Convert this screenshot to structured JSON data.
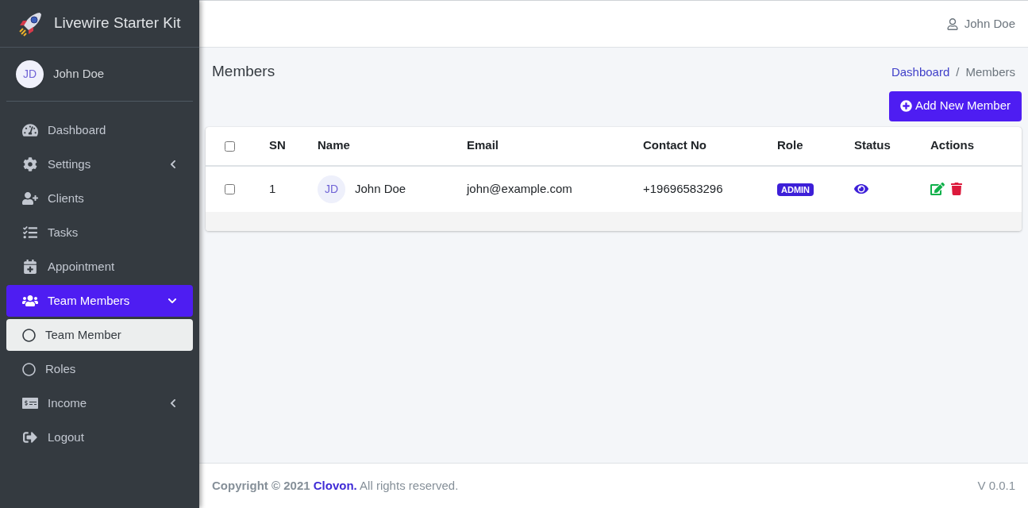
{
  "brand": {
    "name": "Livewire Starter Kit"
  },
  "user": {
    "initials": "JD",
    "name": "John Doe"
  },
  "sidebar": {
    "items": [
      {
        "kind": "link",
        "label": "Dashboard",
        "selected": false
      },
      {
        "kind": "group",
        "label": "Settings",
        "selected": false,
        "expanded": false
      },
      {
        "kind": "link",
        "label": "Clients",
        "selected": false
      },
      {
        "kind": "link",
        "label": "Tasks",
        "selected": false
      },
      {
        "kind": "link",
        "label": "Appointment",
        "selected": false
      },
      {
        "kind": "group",
        "label": "Team Members",
        "selected": true,
        "expanded": true,
        "children": [
          {
            "kind": "sub",
            "label": "Team Member",
            "selected": true
          },
          {
            "kind": "sub",
            "label": "Roles",
            "selected": false
          }
        ]
      },
      {
        "kind": "group",
        "label": "Income",
        "selected": false,
        "expanded": false
      },
      {
        "kind": "link",
        "label": "Logout",
        "selected": false
      }
    ]
  },
  "header": {
    "user": "John Doe"
  },
  "page": {
    "title": "Members",
    "breadcrumb_separator": "/",
    "breadcrumb": [
      {
        "label": "Dashboard",
        "link": true
      },
      {
        "label": "Members",
        "link": false
      }
    ],
    "add_button": "Add New Member"
  },
  "table": {
    "select_all": {
      "checked": false
    },
    "columns": [
      "SN",
      "Name",
      "Email",
      "Contact No",
      "Role",
      "Status",
      "Actions"
    ],
    "rows": [
      {
        "checked": false,
        "sn": "1",
        "initials": "JD",
        "name": "John Doe",
        "email": "john@example.com",
        "contact": "+19696583296",
        "role": "ADMIN"
      }
    ]
  },
  "footer": {
    "copyright": "Copyright © 2021",
    "company": "Clovon.",
    "rights": "All rights reserved.",
    "version": "V 0.0.1"
  }
}
